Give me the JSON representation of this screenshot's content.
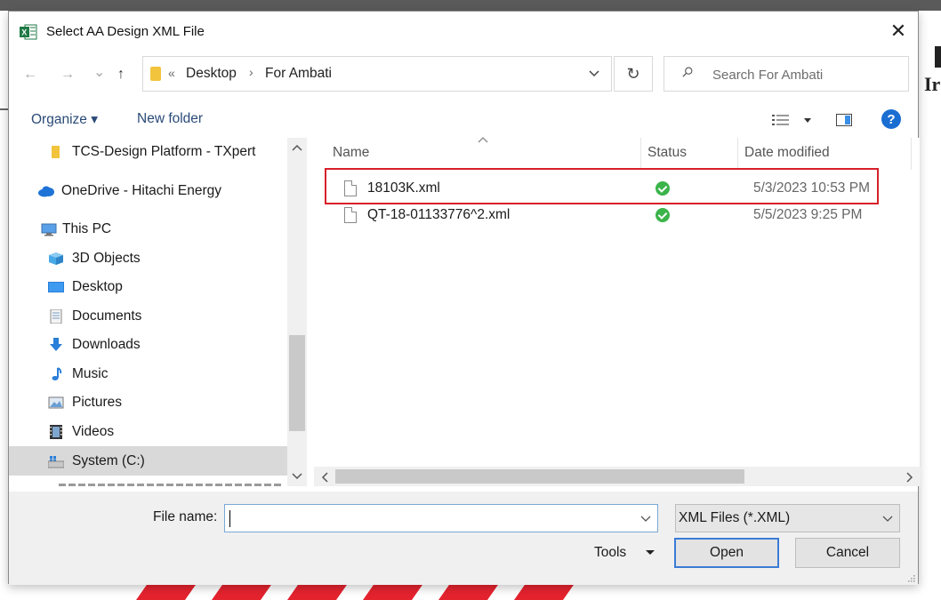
{
  "dialog": {
    "title": "Select AA Design XML File",
    "close_glyph": "✕"
  },
  "nav": {
    "back_glyph": "←",
    "forward_glyph": "→",
    "recent_glyph": "⌄",
    "up_glyph": "↑",
    "breadcrumb_overflow": "«",
    "breadcrumb": [
      "Desktop",
      "For Ambati"
    ],
    "breadcrumb_separator": "›",
    "refresh_glyph": "↻",
    "search_placeholder": "Search For Ambati"
  },
  "toolbar": {
    "organize_label": "Organize ▾",
    "new_folder_label": "New folder",
    "help_glyph": "?"
  },
  "sidebar": {
    "items": [
      {
        "label": "TCS-Design Platform - TXpert",
        "icon": "folder-icon"
      },
      {
        "label": "OneDrive - Hitachi Energy",
        "icon": "onedrive-icon"
      },
      {
        "label": "This PC",
        "icon": "computer-icon"
      },
      {
        "label": "3D Objects",
        "icon": "cube-icon"
      },
      {
        "label": "Desktop",
        "icon": "desktop-icon"
      },
      {
        "label": "Documents",
        "icon": "documents-icon"
      },
      {
        "label": "Downloads",
        "icon": "download-arrow-icon"
      },
      {
        "label": "Music",
        "icon": "music-note-icon"
      },
      {
        "label": "Pictures",
        "icon": "picture-icon"
      },
      {
        "label": "Videos",
        "icon": "video-icon"
      },
      {
        "label": "System (C:)",
        "icon": "drive-icon",
        "selected": true
      }
    ]
  },
  "files": {
    "columns": [
      "Name",
      "Status",
      "Date modified"
    ],
    "rows": [
      {
        "name": "18103K.xml",
        "status": "synced",
        "date": "5/3/2023 10:53 PM",
        "highlighted": true
      },
      {
        "name": "QT-18-01133776^2.xml",
        "status": "synced",
        "date": "5/5/2023 9:25 PM"
      }
    ]
  },
  "bottom": {
    "file_name_label": "File name:",
    "file_name_value": "",
    "file_type_value": "XML Files (*.XML)",
    "tools_label": "Tools",
    "open_label": "Open",
    "cancel_label": "Cancel"
  },
  "background": {
    "partial_text": "Ir"
  },
  "colors": {
    "highlight_border": "#d7202a",
    "status_ok": "#3bb44a",
    "accent_blue": "#3a7bd5",
    "link_blue": "#2a4a78"
  }
}
